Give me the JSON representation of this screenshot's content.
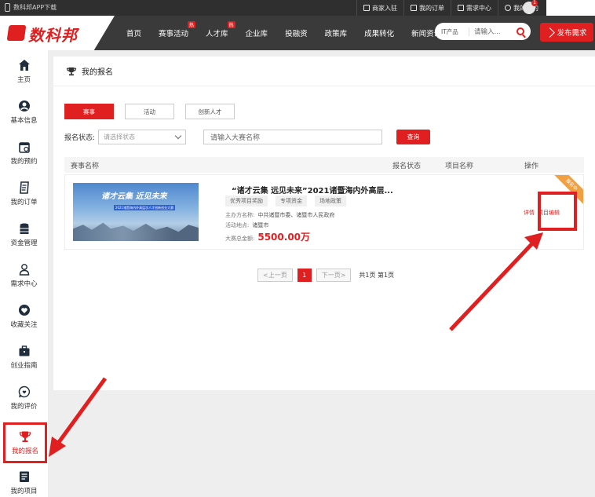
{
  "topbar": {
    "app_download": "数科邦APP下载",
    "links": [
      "商家入驻",
      "我的订单",
      "需求中心",
      "我的预约"
    ],
    "notification_count": "1"
  },
  "header": {
    "logo_text": "数科邦",
    "nav": [
      {
        "label": "首页",
        "hot": ""
      },
      {
        "label": "赛事活动",
        "hot": "热"
      },
      {
        "label": "人才库",
        "hot": "热"
      },
      {
        "label": "企业库",
        "hot": ""
      },
      {
        "label": "投融资",
        "hot": ""
      },
      {
        "label": "政策库",
        "hot": ""
      },
      {
        "label": "成果转化",
        "hot": ""
      },
      {
        "label": "新闻资讯",
        "hot": ""
      }
    ],
    "search_category": "IT产品",
    "search_placeholder": "请输入...",
    "publish_label": "发布需求"
  },
  "sidebar": {
    "items": [
      {
        "label": "主页",
        "icon": "home-icon"
      },
      {
        "label": "基本信息",
        "icon": "user-icon"
      },
      {
        "label": "我的预约",
        "icon": "calendar-icon"
      },
      {
        "label": "我的订单",
        "icon": "order-icon"
      },
      {
        "label": "资金管理",
        "icon": "coins-icon"
      },
      {
        "label": "需求中心",
        "icon": "person-icon"
      },
      {
        "label": "收藏关注",
        "icon": "heart-icon"
      },
      {
        "label": "创业指南",
        "icon": "briefcase-icon"
      },
      {
        "label": "我的评价",
        "icon": "comment-icon"
      },
      {
        "label": "我的报名",
        "icon": "trophy-icon"
      },
      {
        "label": "我的项目",
        "icon": "folder-icon"
      }
    ],
    "active_index": 9
  },
  "page": {
    "title": "我的报名",
    "tabs": [
      "赛事",
      "活动",
      "创新人才"
    ],
    "active_tab": 0,
    "filter_label": "报名状态:",
    "filter_placeholder": "请选择状态",
    "name_placeholder": "请输入大赛名称",
    "query_label": "查询",
    "columns": [
      "赛事名称",
      "报名状态",
      "项目名称",
      "操作"
    ]
  },
  "row": {
    "banner_title": "诸才云集 近见未来",
    "banner_sub": "2021诸暨海内外高层次人才创新创业大赛",
    "title": "“诸才云集 远见未来”2021诸暨海内外高层...",
    "tags": [
      "优秀项目奖励",
      "专项资金",
      "场地政策"
    ],
    "host_label": "主办方名称:",
    "host_value": "中共诸暨市委、诸暨市人民政府",
    "place_label": "活动地点:",
    "place_value": "诸暨市",
    "prize_label": "大赛总金额:",
    "prize_value": "5500.00万",
    "status": "",
    "ops": [
      "详情",
      "项目编辑"
    ],
    "ribbon": "报名中"
  },
  "pager": {
    "prev": "<上一页",
    "current": "1",
    "next": "下一页>",
    "info": "共1页 第1页"
  },
  "colors": {
    "accent": "#e02020",
    "header": "#3a3a3a"
  }
}
